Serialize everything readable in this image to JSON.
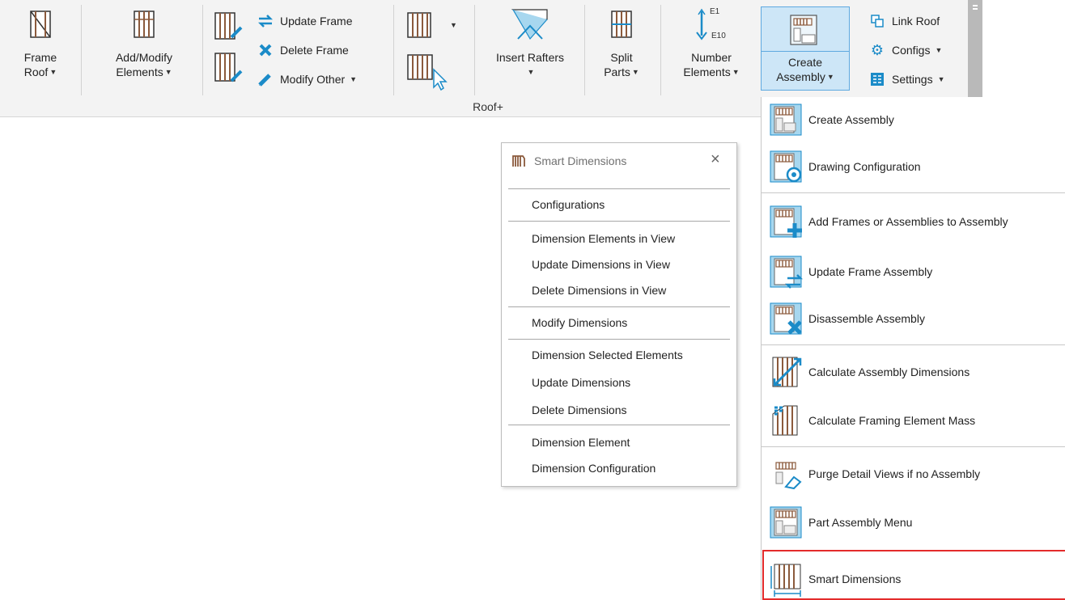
{
  "ribbon": {
    "panel_title": "Roof+",
    "frame_roof": {
      "line1": "Frame",
      "line2": "Roof"
    },
    "add_modify": {
      "line1": "Add/Modify",
      "line2": "Elements"
    },
    "update_frame": "Update Frame",
    "delete_frame": "Delete Frame",
    "modify_other": "Modify Other",
    "insert_rafters": "Insert Rafters",
    "split_parts": {
      "line1": "Split",
      "line2": "Parts"
    },
    "number_elements": {
      "line1": "Number",
      "line2": "Elements",
      "tag_top": "E1",
      "tag_bottom": "E10"
    },
    "create_assembly": {
      "line1": "Create",
      "line2": "Assembly"
    },
    "link_roof": "Link Roof",
    "configs": "Configs",
    "settings": "Settings"
  },
  "smart_dimensions": {
    "title": "Smart Dimensions",
    "close": "×",
    "groups": [
      [
        "Configurations"
      ],
      [
        "Dimension Elements in View",
        "Update Dimensions in View",
        "Delete Dimensions in View"
      ],
      [
        "Modify Dimensions"
      ],
      [
        "Dimension Selected Elements",
        "Update Dimensions",
        "Delete Dimensions"
      ],
      [
        "Dimension Element",
        "Dimension Configuration"
      ]
    ]
  },
  "assembly_menu": {
    "items": [
      {
        "label": "Create Assembly",
        "icon": "create-assembly-icon"
      },
      {
        "label": "Drawing Configuration",
        "icon": "drawing-configuration-icon"
      },
      {
        "label": "Add Frames or Assemblies to Assembly",
        "icon": "add-frames-icon"
      },
      {
        "label": "Update Frame Assembly",
        "icon": "update-frame-assembly-icon"
      },
      {
        "label": "Disassemble Assembly",
        "icon": "disassemble-icon"
      },
      {
        "label": "Calculate Assembly Dimensions",
        "icon": "calculate-dimensions-icon"
      },
      {
        "label": "Calculate Framing Element Mass",
        "icon": "calculate-mass-icon"
      },
      {
        "label": "Purge Detail Views if no Assembly",
        "icon": "purge-icon"
      },
      {
        "label": "Part Assembly Menu",
        "icon": "part-assembly-icon"
      },
      {
        "label": "Smart Dimensions",
        "icon": "smart-dimensions-icon"
      }
    ]
  },
  "colors": {
    "accent_blue": "#1b8bc8",
    "wood_brown": "#8b5a3c",
    "highlight_red": "#e32b2b"
  }
}
